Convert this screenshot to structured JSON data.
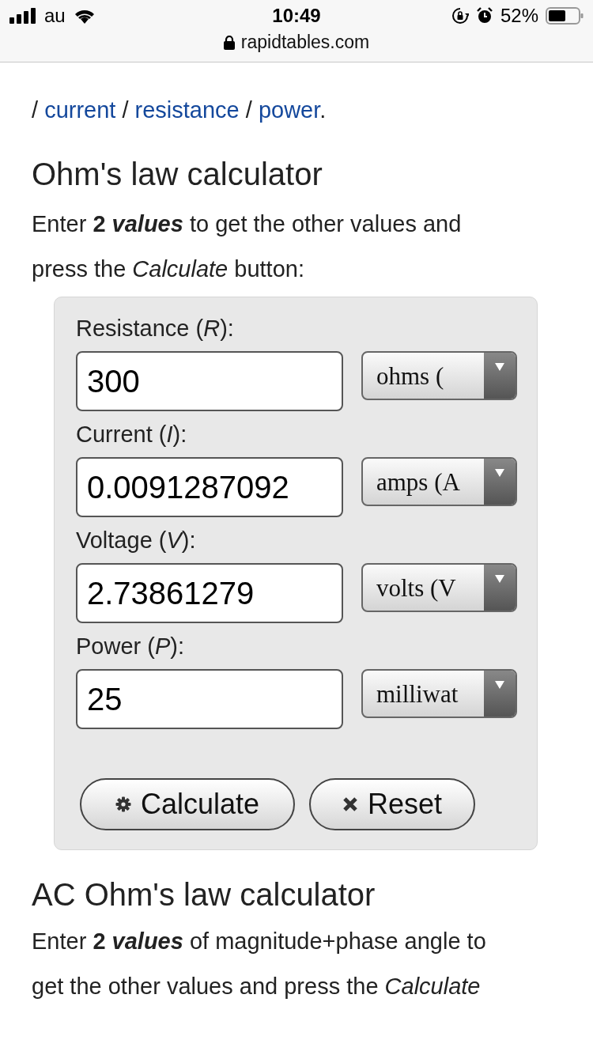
{
  "status_bar": {
    "carrier": "au",
    "time": "10:49",
    "battery": "52%"
  },
  "address_bar": {
    "url": "rapidtables.com"
  },
  "intro": [
    {
      "text": "/ "
    },
    {
      "text": "current",
      "link": true
    },
    {
      "text": " / "
    },
    {
      "text": "resistance",
      "link": true
    },
    {
      "text": " / "
    },
    {
      "text": "power",
      "link": true
    },
    {
      "text": "."
    }
  ],
  "heading": "Ohm's law calculator",
  "instructions": [
    {
      "text": "Enter "
    },
    {
      "text": "2 ",
      "kind": "bold"
    },
    {
      "text": "values",
      "kind": "bold-italic"
    },
    {
      "text": " to get the other values and press the "
    },
    {
      "text": "Calculate",
      "kind": "italic"
    },
    {
      "text": " button:"
    }
  ],
  "fields": [
    {
      "label": "Resistance (*R*):",
      "value": "300",
      "unit": "ohms ("
    },
    {
      "label": "Current (*I*):",
      "value": "0.0091287092",
      "unit": "amps (A"
    },
    {
      "label": "Voltage (*V*):",
      "value": "2.73861279",
      "unit": "volts (V"
    },
    {
      "label": "Power (*P*):",
      "value": "25",
      "unit": "milliwat"
    }
  ],
  "buttons": [
    {
      "label": "Calculate",
      "kind": "calculate"
    },
    {
      "label": "Reset",
      "kind": "reset"
    }
  ],
  "ac_heading": "AC Ohm's law calculator",
  "ac_instructions": [
    {
      "text": "Enter "
    },
    {
      "text": "2 ",
      "kind": "bold"
    },
    {
      "text": "values",
      "kind": "bold-italic"
    },
    {
      "text": " of magnitude+phase angle to get the other values and press the "
    },
    {
      "text": "Calculate",
      "kind": "italic"
    }
  ]
}
